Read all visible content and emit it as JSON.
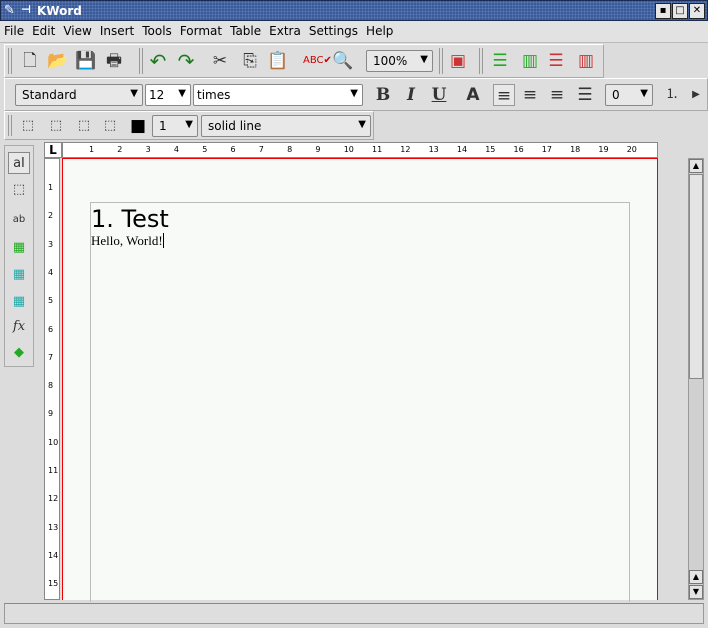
{
  "window": {
    "title": "KWord"
  },
  "menu": [
    "File",
    "Edit",
    "View",
    "Insert",
    "Tools",
    "Format",
    "Table",
    "Extra",
    "Settings",
    "Help"
  ],
  "toolbar": {
    "zoom": "100%",
    "style": "Standard",
    "font_size": "12",
    "font": "times",
    "indent": "0",
    "border_width": "1",
    "border_style": "solid line",
    "bold": "B",
    "italic": "I",
    "underline": "U"
  },
  "ruler_h": [
    "1",
    "2",
    "3",
    "4",
    "5",
    "6",
    "7",
    "8",
    "9",
    "10",
    "11",
    "12",
    "13",
    "14",
    "15",
    "16",
    "17",
    "18",
    "19",
    "20"
  ],
  "ruler_v": [
    "1",
    "2",
    "3",
    "4",
    "5",
    "6",
    "7",
    "8",
    "9",
    "10",
    "11",
    "12",
    "13",
    "14",
    "15"
  ],
  "document": {
    "heading": "1.  Test",
    "body": "Hello, World!"
  },
  "colors": {
    "accent": "#3a5a98",
    "page_border": "#e00000"
  }
}
